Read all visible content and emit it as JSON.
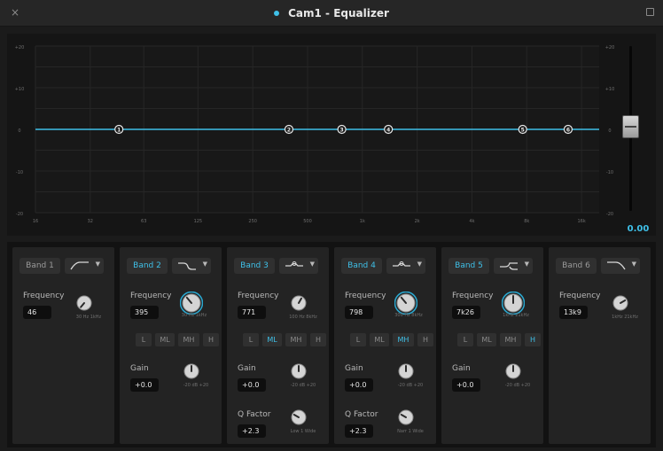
{
  "window": {
    "title": "Cam1 - Equalizer",
    "accent": "#3fc0e8",
    "close_glyph": "×"
  },
  "graph": {
    "left_db_labels": [
      "+20",
      "+10",
      "0",
      "-10",
      "-20"
    ],
    "right_db_labels": [
      "+20",
      "+10",
      "0",
      "-10",
      "-20"
    ],
    "freq_labels": [
      "16",
      "32",
      "63",
      "125",
      "250",
      "500",
      "1k",
      "2k",
      "4k",
      "8k",
      "16k"
    ],
    "nodes": [
      {
        "label": "1",
        "freq_hz": 46
      },
      {
        "label": "2",
        "freq_hz": 395
      },
      {
        "label": "3",
        "freq_hz": 771
      },
      {
        "label": "4",
        "freq_hz": 1390
      },
      {
        "label": "5",
        "freq_hz": 7600
      },
      {
        "label": "6",
        "freq_hz": 13500
      }
    ],
    "output_gain_value": "0.00",
    "fader_level_db": 0
  },
  "bands": [
    {
      "label": "Band 1",
      "enabled": false,
      "shape_icon": "high-pass-filter-icon",
      "frequency_label": "Frequency",
      "frequency_value": "46",
      "frequency_scale": "30 Hz  1kHz",
      "frequency_knob_deg": 220
    },
    {
      "label": "Band 2",
      "enabled": true,
      "shape_icon": "low-shelf-icon",
      "frequency_label": "Frequency",
      "frequency_value": "395",
      "frequency_scale": "30 Hz  1kHz",
      "frequency_knob_deg": 320,
      "ranges": [
        "L",
        "ML",
        "MH",
        "H"
      ],
      "active_range": "",
      "gain_label": "Gain",
      "gain_value": "+0.0",
      "gain_scale": "-20  dB  +20"
    },
    {
      "label": "Band 3",
      "enabled": true,
      "shape_icon": "bell-icon",
      "frequency_label": "Frequency",
      "frequency_value": "771",
      "frequency_scale": "100 Hz  8kHz",
      "frequency_knob_deg": 30,
      "ranges": [
        "L",
        "ML",
        "MH",
        "H"
      ],
      "active_range": "ML",
      "gain_label": "Gain",
      "gain_value": "+0.0",
      "gain_scale": "-20  dB  +20",
      "q_label": "Q Factor",
      "q_value": "+2.3",
      "q_scale": "Low   1  Wide"
    },
    {
      "label": "Band 4",
      "enabled": true,
      "shape_icon": "bell-icon",
      "frequency_label": "Frequency",
      "frequency_value": "798",
      "frequency_scale": "300 Hz  8kHz",
      "frequency_knob_deg": 320,
      "ranges": [
        "L",
        "ML",
        "MH",
        "H"
      ],
      "active_range": "MH",
      "gain_label": "Gain",
      "gain_value": "+0.0",
      "gain_scale": "-20  dB  +20",
      "q_label": "Q Factor",
      "q_value": "+2.3",
      "q_scale": "Narr   1  Wide"
    },
    {
      "label": "Band 5",
      "enabled": true,
      "shape_icon": "high-shelf-icon",
      "frequency_label": "Frequency",
      "frequency_value": "7k26",
      "frequency_scale": "1kHz  21kHz",
      "frequency_knob_deg": 0,
      "ranges": [
        "L",
        "ML",
        "MH",
        "H"
      ],
      "active_range": "H",
      "gain_label": "Gain",
      "gain_value": "+0.0",
      "gain_scale": "-20  dB  +20"
    },
    {
      "label": "Band 6",
      "enabled": false,
      "shape_icon": "low-pass-filter-icon",
      "frequency_label": "Frequency",
      "frequency_value": "13k9",
      "frequency_scale": "1kHz  21kHz",
      "frequency_knob_deg": 60
    }
  ]
}
